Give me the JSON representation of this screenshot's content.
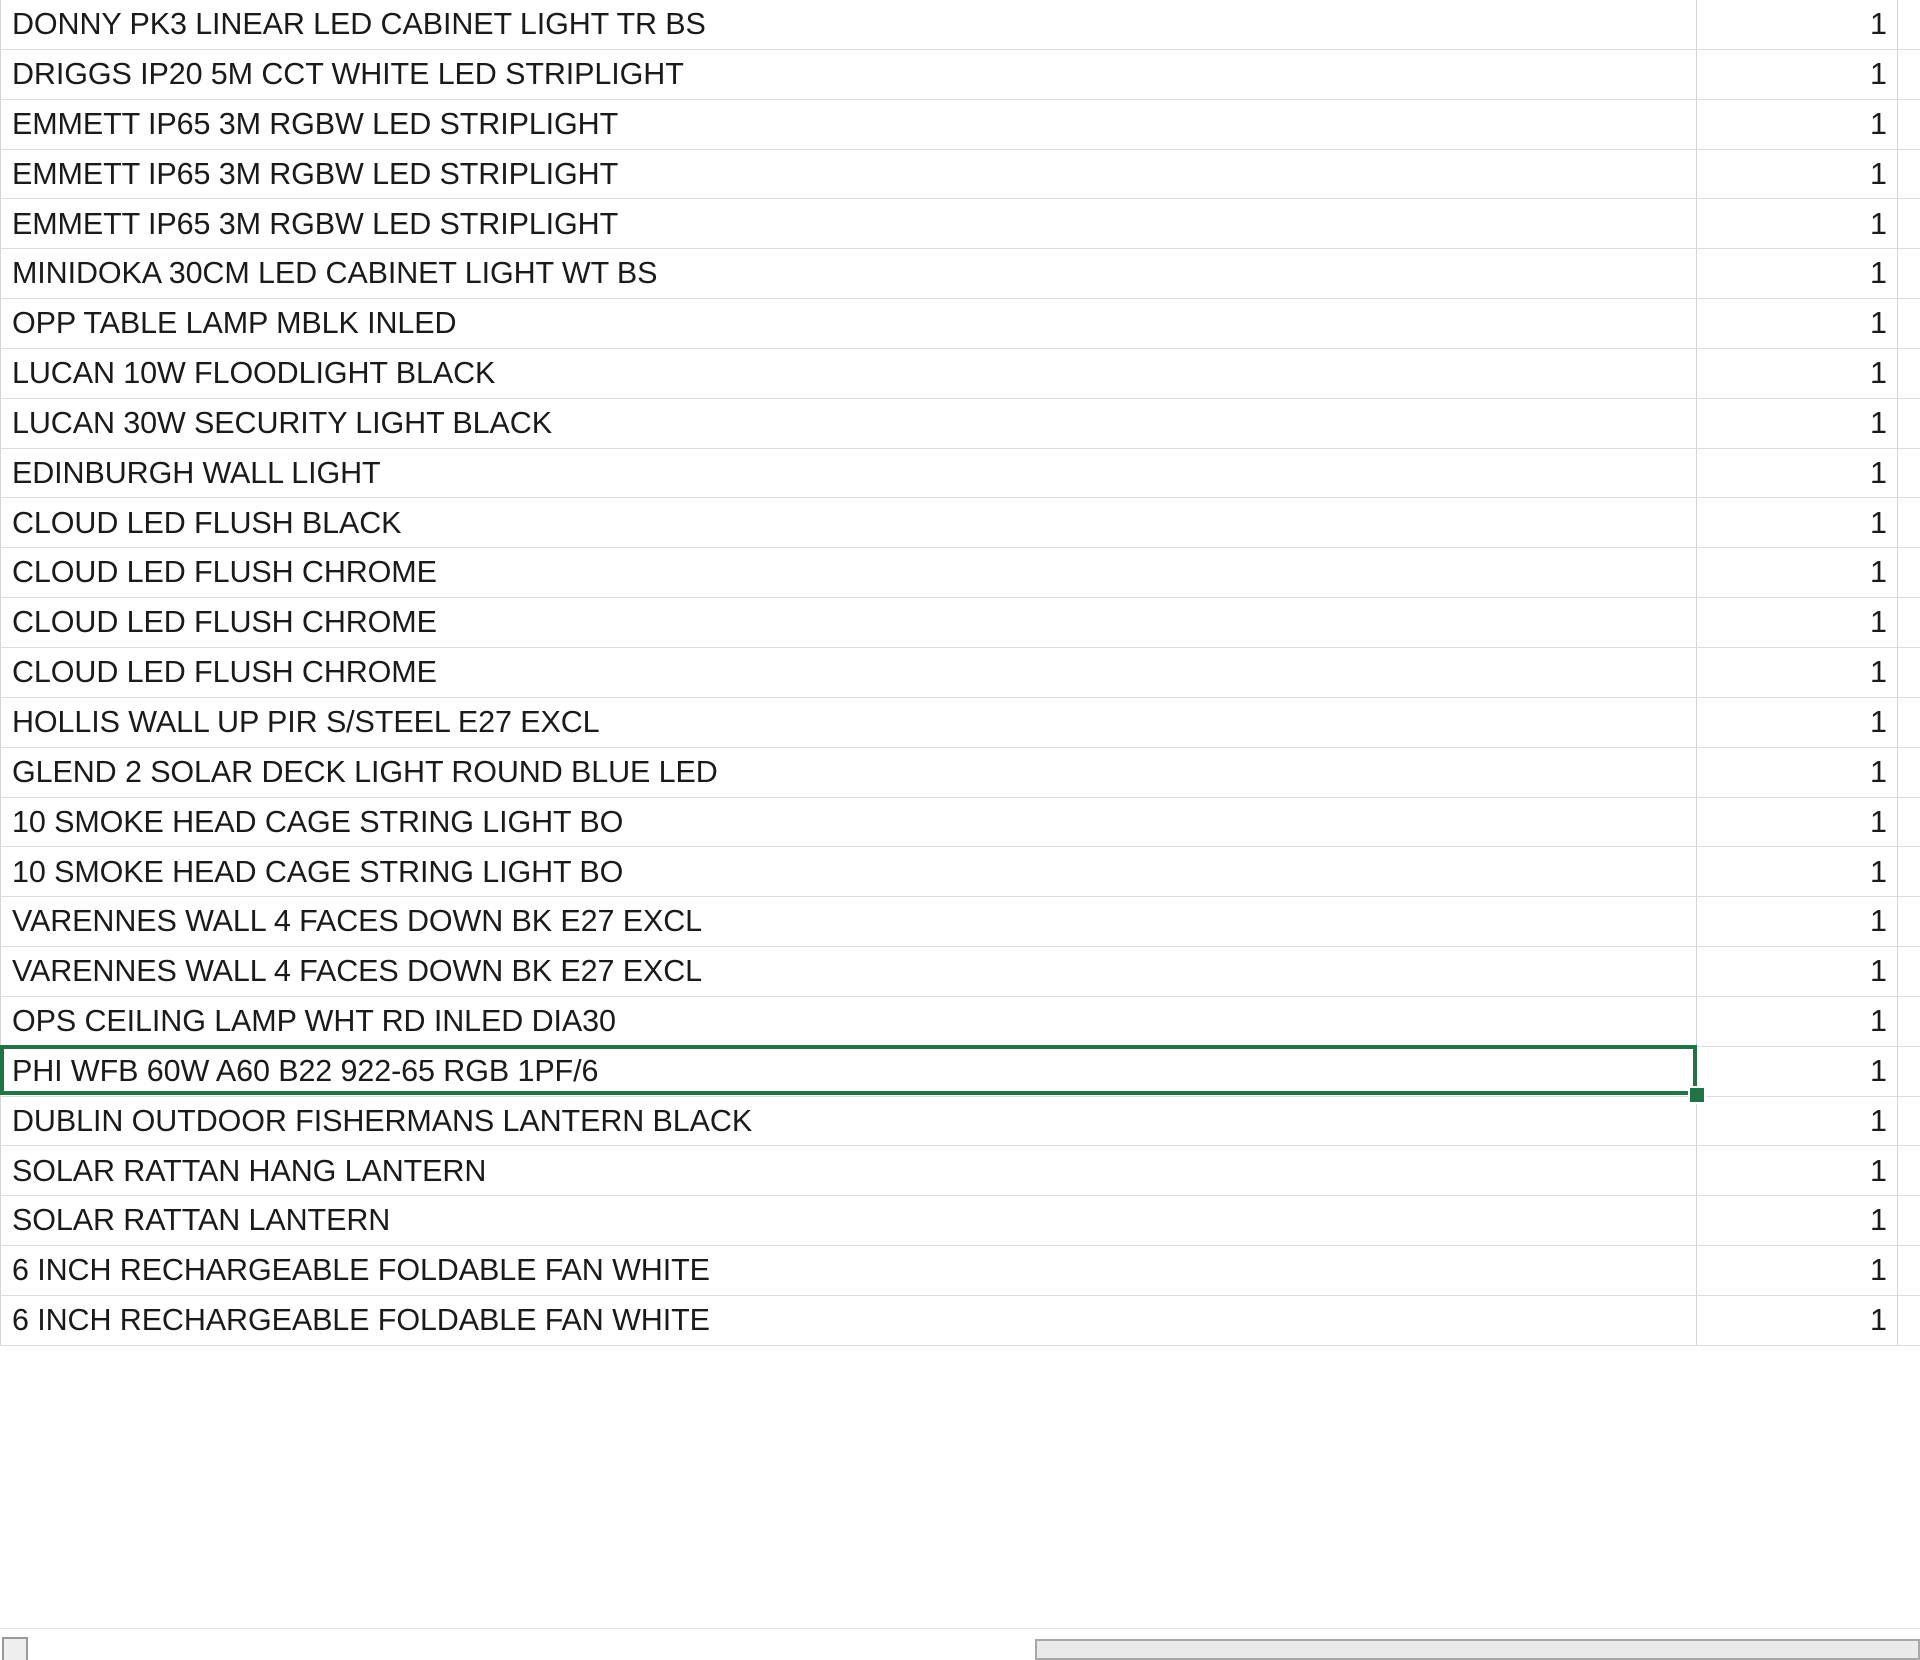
{
  "app": {
    "type": "spreadsheet",
    "accent_selection_color": "#217346",
    "gridline_color": "#d4d4d4",
    "text_color": "#1a1a1a",
    "background_color": "#ffffff"
  },
  "table": {
    "columns": [
      {
        "key": "description",
        "header": "",
        "align": "left"
      },
      {
        "key": "quantity",
        "header": "",
        "align": "right"
      }
    ],
    "selected_row_index": 18,
    "rows": [
      {
        "description": "DONNY PK3 LINEAR LED CABINET LIGHT TR BS",
        "quantity": "1"
      },
      {
        "description": "DRIGGS IP20 5M CCT WHITE LED STRIPLIGHT",
        "quantity": "1"
      },
      {
        "description": "EMMETT IP65 3M RGBW LED STRIPLIGHT",
        "quantity": "1"
      },
      {
        "description": "EMMETT IP65 3M RGBW LED STRIPLIGHT",
        "quantity": "1"
      },
      {
        "description": "EMMETT IP65 3M RGBW LED STRIPLIGHT",
        "quantity": "1"
      },
      {
        "description": "MINIDOKA 30CM LED CABINET LIGHT WT BS",
        "quantity": "1"
      },
      {
        "description": "OPP TABLE LAMP MBLK INLED",
        "quantity": "1"
      },
      {
        "description": "LUCAN 10W FLOODLIGHT BLACK",
        "quantity": "1"
      },
      {
        "description": "LUCAN 30W SECURITY LIGHT BLACK",
        "quantity": "1"
      },
      {
        "description": "EDINBURGH WALL LIGHT",
        "quantity": "1"
      },
      {
        "description": "CLOUD LED FLUSH BLACK",
        "quantity": "1"
      },
      {
        "description": "CLOUD LED FLUSH CHROME",
        "quantity": "1"
      },
      {
        "description": "CLOUD LED FLUSH CHROME",
        "quantity": "1"
      },
      {
        "description": "CLOUD LED FLUSH CHROME",
        "quantity": "1"
      },
      {
        "description": "HOLLIS WALL UP PIR S/STEEL E27 EXCL",
        "quantity": "1"
      },
      {
        "description": "GLEND 2 SOLAR DECK LIGHT ROUND BLUE LED",
        "quantity": "1"
      },
      {
        "description": "10 SMOKE HEAD CAGE STRING LIGHT BO",
        "quantity": "1"
      },
      {
        "description": "10 SMOKE HEAD CAGE STRING LIGHT BO",
        "quantity": "1"
      },
      {
        "description": "VARENNES WALL 4 FACES DOWN BK E27 EXCL",
        "quantity": "1"
      },
      {
        "description": "VARENNES WALL 4 FACES DOWN BK E27 EXCL",
        "quantity": "1"
      },
      {
        "description": "OPS CEILING LAMP WHT RD INLED DIA30",
        "quantity": "1"
      },
      {
        "description": "PHI WFB 60W A60 B22 922-65 RGB 1PF/6",
        "quantity": "1"
      },
      {
        "description": "DUBLIN OUTDOOR FISHERMANS LANTERN BLACK",
        "quantity": "1"
      },
      {
        "description": "SOLAR RATTAN HANG LANTERN",
        "quantity": "1"
      },
      {
        "description": "SOLAR RATTAN LANTERN",
        "quantity": "1"
      },
      {
        "description": "6 INCH RECHARGEABLE FOLDABLE FAN WHITE",
        "quantity": "1"
      },
      {
        "description": "6 INCH RECHARGEABLE FOLDABLE FAN WHITE",
        "quantity": "1"
      }
    ]
  },
  "active_cell": {
    "value": "10 SMOKE HEAD CAGE STRING LIGHT BO"
  },
  "scrollbar": {
    "orientation": "horizontal",
    "thumb_position_percent": 55
  }
}
